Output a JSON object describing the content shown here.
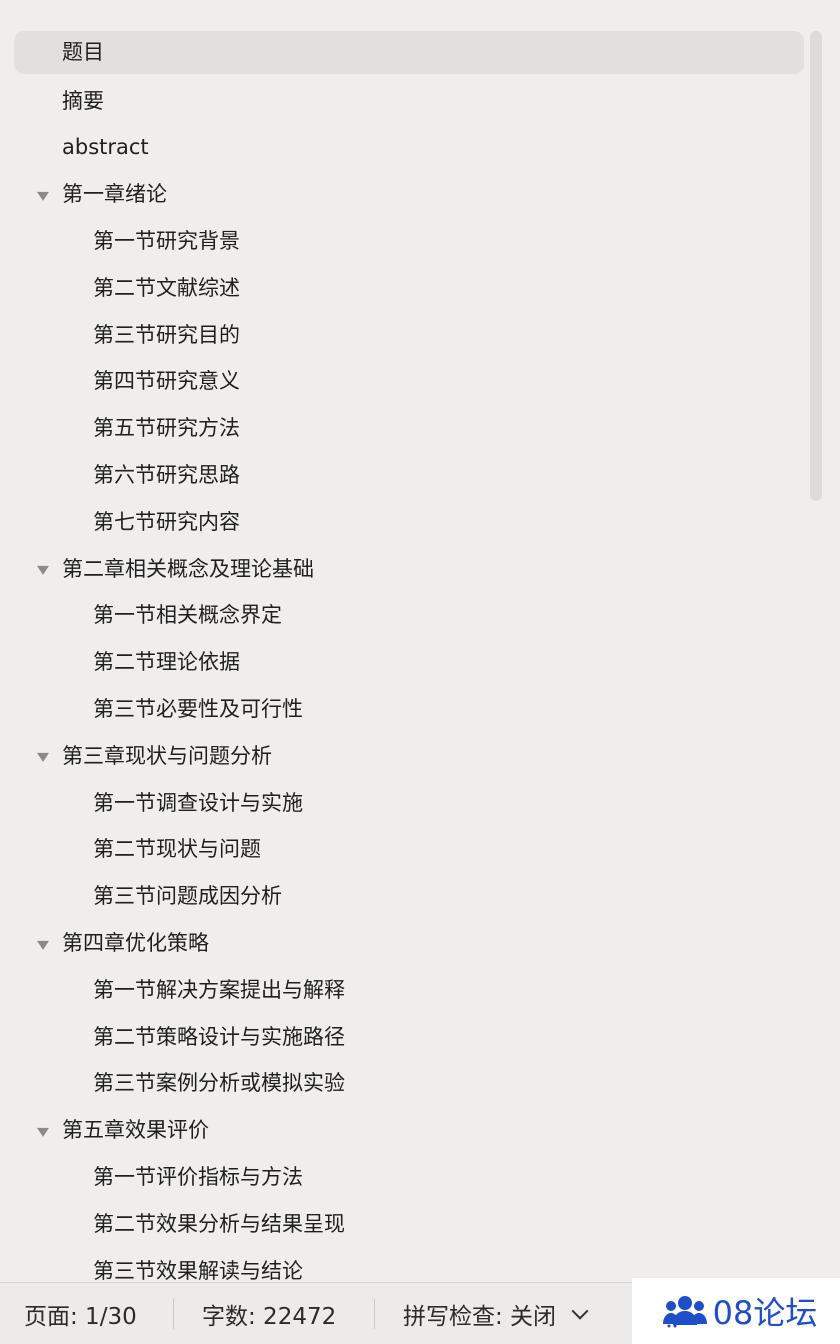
{
  "outline": {
    "items": [
      {
        "label": "题目",
        "level": 0,
        "selected": true,
        "expanded": null
      },
      {
        "label": "摘要",
        "level": 0,
        "selected": false,
        "expanded": null
      },
      {
        "label": "abstract",
        "level": 0,
        "selected": false,
        "expanded": null
      },
      {
        "label": "第一章绪论",
        "level": 0,
        "selected": false,
        "expanded": true
      },
      {
        "label": "第一节研究背景",
        "level": 1,
        "selected": false,
        "expanded": null
      },
      {
        "label": "第二节文献综述",
        "level": 1,
        "selected": false,
        "expanded": null
      },
      {
        "label": "第三节研究目的",
        "level": 1,
        "selected": false,
        "expanded": null
      },
      {
        "label": "第四节研究意义",
        "level": 1,
        "selected": false,
        "expanded": null
      },
      {
        "label": "第五节研究方法",
        "level": 1,
        "selected": false,
        "expanded": null
      },
      {
        "label": "第六节研究思路",
        "level": 1,
        "selected": false,
        "expanded": null
      },
      {
        "label": "第七节研究内容",
        "level": 1,
        "selected": false,
        "expanded": null
      },
      {
        "label": "第二章相关概念及理论基础",
        "level": 0,
        "selected": false,
        "expanded": true
      },
      {
        "label": "第一节相关概念界定",
        "level": 1,
        "selected": false,
        "expanded": null
      },
      {
        "label": "第二节理论依据",
        "level": 1,
        "selected": false,
        "expanded": null
      },
      {
        "label": "第三节必要性及可行性",
        "level": 1,
        "selected": false,
        "expanded": null
      },
      {
        "label": "第三章现状与问题分析",
        "level": 0,
        "selected": false,
        "expanded": true
      },
      {
        "label": "第一节调查设计与实施",
        "level": 1,
        "selected": false,
        "expanded": null
      },
      {
        "label": "第二节现状与问题",
        "level": 1,
        "selected": false,
        "expanded": null
      },
      {
        "label": "第三节问题成因分析",
        "level": 1,
        "selected": false,
        "expanded": null
      },
      {
        "label": "第四章优化策略",
        "level": 0,
        "selected": false,
        "expanded": true
      },
      {
        "label": "第一节解决方案提出与解释",
        "level": 1,
        "selected": false,
        "expanded": null
      },
      {
        "label": "第二节策略设计与实施路径",
        "level": 1,
        "selected": false,
        "expanded": null
      },
      {
        "label": "第三节案例分析或模拟实验",
        "level": 1,
        "selected": false,
        "expanded": null
      },
      {
        "label": "第五章效果评价",
        "level": 0,
        "selected": false,
        "expanded": true
      },
      {
        "label": "第一节评价指标与方法",
        "level": 1,
        "selected": false,
        "expanded": null
      },
      {
        "label": "第二节效果分析与结果呈现",
        "level": 1,
        "selected": false,
        "expanded": null
      },
      {
        "label": "第三节效果解读与结论",
        "level": 1,
        "selected": false,
        "expanded": null
      }
    ]
  },
  "statusbar": {
    "page": "页面: 1/30",
    "words": "字数: 22472",
    "spellcheck": "拼写检查: 关闭"
  },
  "watermark": {
    "text": "08论坛",
    "icon": "people-icon"
  },
  "colors": {
    "background": "#efeeec",
    "selected_item": "#e1e0de",
    "toggle": "#8a8a8a",
    "watermark_text": "#1e4fc8"
  }
}
